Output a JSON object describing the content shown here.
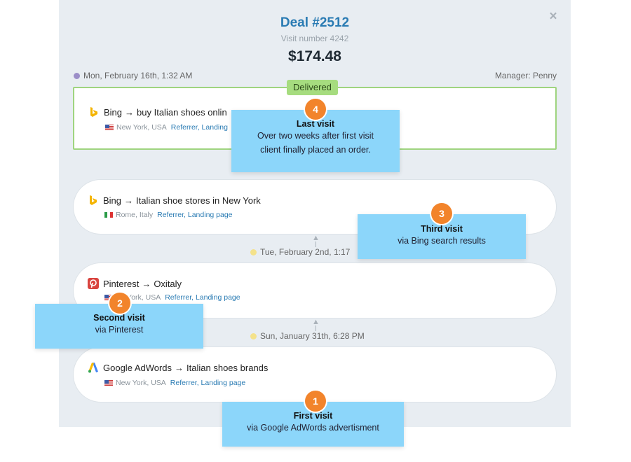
{
  "deal": {
    "title": "Deal #2512",
    "visit_number": "Visit number 4242",
    "amount": "$174.48"
  },
  "header": {
    "date": "Mon, February 16th, 1:32 AM",
    "manager": "Manager: Penny"
  },
  "close_icon": "×",
  "badge": {
    "label": "Delivered",
    "color": "#a6dc7f"
  },
  "visits": [
    {
      "source": "Bing",
      "arrow": "→",
      "query": "buy Italian shoes onlin",
      "location": "New York, USA",
      "links": "Referrer, Landing",
      "flag": "us",
      "icon": "bing-icon"
    },
    {
      "source": "Bing",
      "arrow": "→",
      "query": "Italian shoe stores in New York",
      "location": "Rome, Italy",
      "links": "Referrer, Landing page",
      "flag": "it",
      "icon": "bing-icon"
    },
    {
      "source": "Pinterest",
      "arrow": "→",
      "query": "Oxitaly",
      "location": "ew York, USA",
      "links": "Referrer, Landing page",
      "flag": "us",
      "icon": "pinterest-icon"
    },
    {
      "source": "Google AdWords",
      "arrow": "→",
      "query": "Italian shoes brands",
      "location": "New York, USA",
      "links": "Referrer, Landing page",
      "flag": "us",
      "icon": "adwords-icon"
    }
  ],
  "timeline_dates": {
    "second": "Tue, February 2nd, 1:17",
    "first": "Sun, January 31th, 6:28 PM"
  },
  "callouts": [
    {
      "number": "4",
      "title": "Last visit",
      "lines": [
        "Over two weeks after first visit",
        "client finally placed an order."
      ]
    },
    {
      "number": "3",
      "title": "Third visit",
      "lines": [
        "via Bing search results"
      ]
    },
    {
      "number": "2",
      "title": "Second visit",
      "lines": [
        "via Pinterest"
      ]
    },
    {
      "number": "1",
      "title": "First visit",
      "lines": [
        "via Google AdWords advertisment"
      ]
    }
  ],
  "colors": {
    "accent": "#2a7bb3",
    "callout": "#8cd6fa",
    "step": "#f2842b",
    "delivered_border": "#9fd47f",
    "panel": "#e8edf2"
  }
}
